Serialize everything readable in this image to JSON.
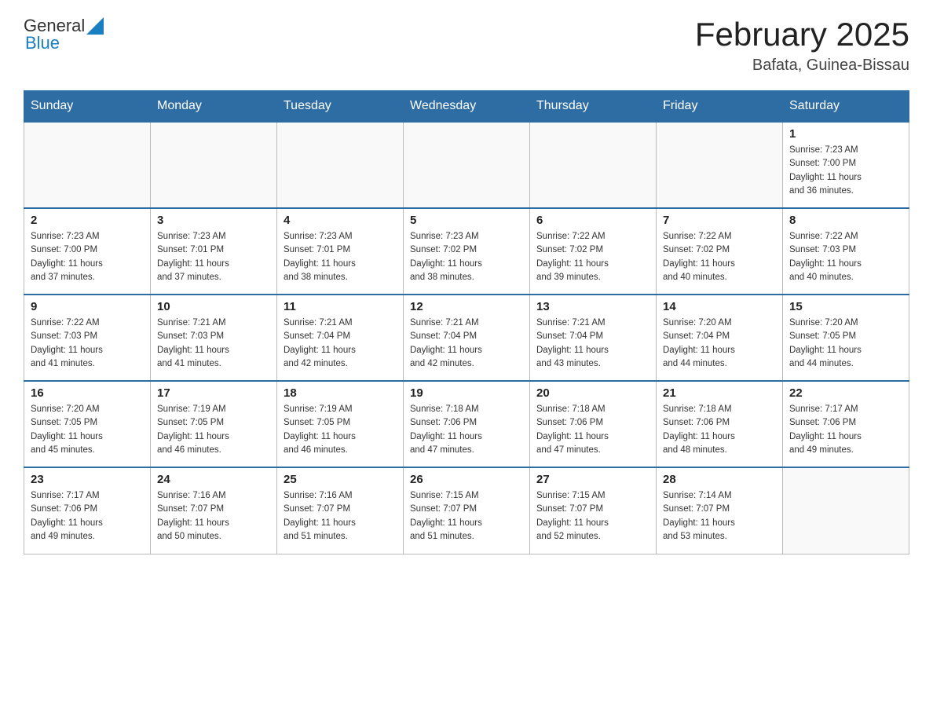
{
  "header": {
    "logo_general": "General",
    "logo_blue": "Blue",
    "month_title": "February 2025",
    "location": "Bafata, Guinea-Bissau"
  },
  "weekdays": [
    "Sunday",
    "Monday",
    "Tuesday",
    "Wednesday",
    "Thursday",
    "Friday",
    "Saturday"
  ],
  "weeks": [
    [
      {
        "day": "",
        "info": ""
      },
      {
        "day": "",
        "info": ""
      },
      {
        "day": "",
        "info": ""
      },
      {
        "day": "",
        "info": ""
      },
      {
        "day": "",
        "info": ""
      },
      {
        "day": "",
        "info": ""
      },
      {
        "day": "1",
        "info": "Sunrise: 7:23 AM\nSunset: 7:00 PM\nDaylight: 11 hours\nand 36 minutes."
      }
    ],
    [
      {
        "day": "2",
        "info": "Sunrise: 7:23 AM\nSunset: 7:00 PM\nDaylight: 11 hours\nand 37 minutes."
      },
      {
        "day": "3",
        "info": "Sunrise: 7:23 AM\nSunset: 7:01 PM\nDaylight: 11 hours\nand 37 minutes."
      },
      {
        "day": "4",
        "info": "Sunrise: 7:23 AM\nSunset: 7:01 PM\nDaylight: 11 hours\nand 38 minutes."
      },
      {
        "day": "5",
        "info": "Sunrise: 7:23 AM\nSunset: 7:02 PM\nDaylight: 11 hours\nand 38 minutes."
      },
      {
        "day": "6",
        "info": "Sunrise: 7:22 AM\nSunset: 7:02 PM\nDaylight: 11 hours\nand 39 minutes."
      },
      {
        "day": "7",
        "info": "Sunrise: 7:22 AM\nSunset: 7:02 PM\nDaylight: 11 hours\nand 40 minutes."
      },
      {
        "day": "8",
        "info": "Sunrise: 7:22 AM\nSunset: 7:03 PM\nDaylight: 11 hours\nand 40 minutes."
      }
    ],
    [
      {
        "day": "9",
        "info": "Sunrise: 7:22 AM\nSunset: 7:03 PM\nDaylight: 11 hours\nand 41 minutes."
      },
      {
        "day": "10",
        "info": "Sunrise: 7:21 AM\nSunset: 7:03 PM\nDaylight: 11 hours\nand 41 minutes."
      },
      {
        "day": "11",
        "info": "Sunrise: 7:21 AM\nSunset: 7:04 PM\nDaylight: 11 hours\nand 42 minutes."
      },
      {
        "day": "12",
        "info": "Sunrise: 7:21 AM\nSunset: 7:04 PM\nDaylight: 11 hours\nand 42 minutes."
      },
      {
        "day": "13",
        "info": "Sunrise: 7:21 AM\nSunset: 7:04 PM\nDaylight: 11 hours\nand 43 minutes."
      },
      {
        "day": "14",
        "info": "Sunrise: 7:20 AM\nSunset: 7:04 PM\nDaylight: 11 hours\nand 44 minutes."
      },
      {
        "day": "15",
        "info": "Sunrise: 7:20 AM\nSunset: 7:05 PM\nDaylight: 11 hours\nand 44 minutes."
      }
    ],
    [
      {
        "day": "16",
        "info": "Sunrise: 7:20 AM\nSunset: 7:05 PM\nDaylight: 11 hours\nand 45 minutes."
      },
      {
        "day": "17",
        "info": "Sunrise: 7:19 AM\nSunset: 7:05 PM\nDaylight: 11 hours\nand 46 minutes."
      },
      {
        "day": "18",
        "info": "Sunrise: 7:19 AM\nSunset: 7:05 PM\nDaylight: 11 hours\nand 46 minutes."
      },
      {
        "day": "19",
        "info": "Sunrise: 7:18 AM\nSunset: 7:06 PM\nDaylight: 11 hours\nand 47 minutes."
      },
      {
        "day": "20",
        "info": "Sunrise: 7:18 AM\nSunset: 7:06 PM\nDaylight: 11 hours\nand 47 minutes."
      },
      {
        "day": "21",
        "info": "Sunrise: 7:18 AM\nSunset: 7:06 PM\nDaylight: 11 hours\nand 48 minutes."
      },
      {
        "day": "22",
        "info": "Sunrise: 7:17 AM\nSunset: 7:06 PM\nDaylight: 11 hours\nand 49 minutes."
      }
    ],
    [
      {
        "day": "23",
        "info": "Sunrise: 7:17 AM\nSunset: 7:06 PM\nDaylight: 11 hours\nand 49 minutes."
      },
      {
        "day": "24",
        "info": "Sunrise: 7:16 AM\nSunset: 7:07 PM\nDaylight: 11 hours\nand 50 minutes."
      },
      {
        "day": "25",
        "info": "Sunrise: 7:16 AM\nSunset: 7:07 PM\nDaylight: 11 hours\nand 51 minutes."
      },
      {
        "day": "26",
        "info": "Sunrise: 7:15 AM\nSunset: 7:07 PM\nDaylight: 11 hours\nand 51 minutes."
      },
      {
        "day": "27",
        "info": "Sunrise: 7:15 AM\nSunset: 7:07 PM\nDaylight: 11 hours\nand 52 minutes."
      },
      {
        "day": "28",
        "info": "Sunrise: 7:14 AM\nSunset: 7:07 PM\nDaylight: 11 hours\nand 53 minutes."
      },
      {
        "day": "",
        "info": ""
      }
    ]
  ]
}
